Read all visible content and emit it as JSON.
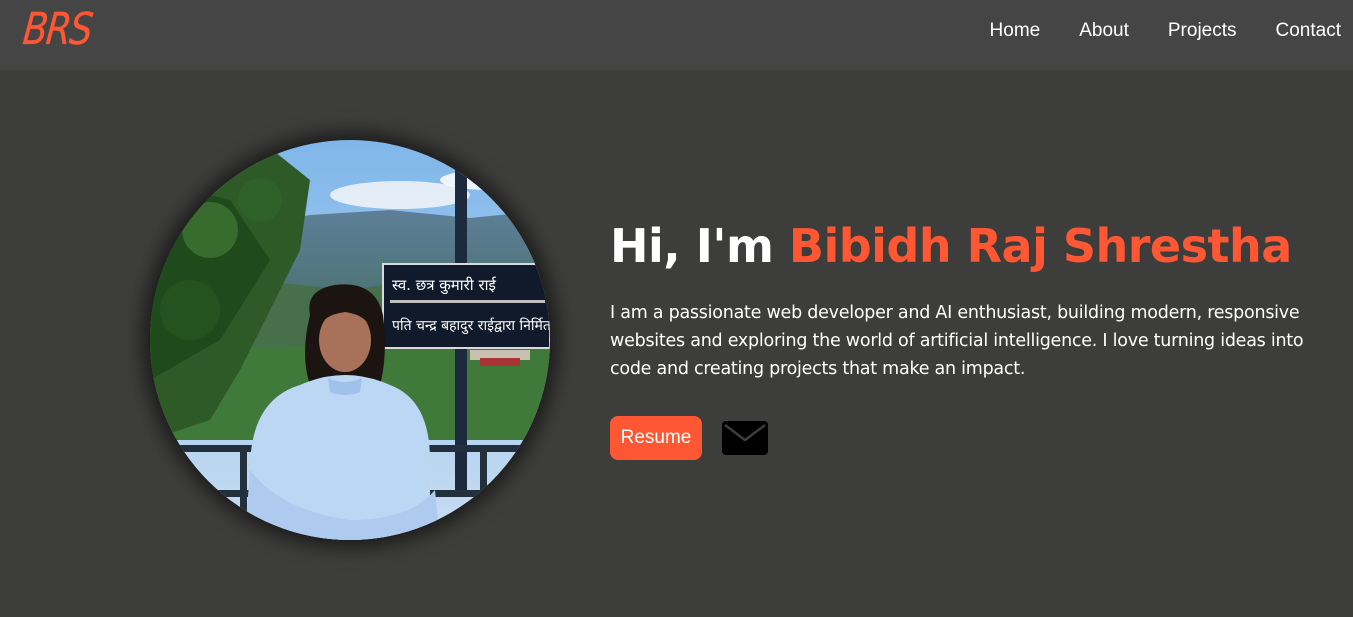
{
  "header": {
    "logo": "BRS",
    "nav": [
      {
        "label": "Home"
      },
      {
        "label": "About"
      },
      {
        "label": "Projects"
      },
      {
        "label": "Contact"
      }
    ]
  },
  "hero": {
    "greeting": "Hi, I'm ",
    "name": "Bibidh Raj Shrestha",
    "intro": "I am a passionate web developer and AI enthusiast, building modern, responsive websites and exploring the world of artificial intelligence. I love turning ideas into code and creating projects that make an impact.",
    "sign_line1": "स्व. छत्र कुमारी राई",
    "sign_line2": "पति चन्द्र बहादुर राईद्वारा निर्मित",
    "resume_label": "Resume",
    "mail_icon": "envelope-icon"
  },
  "colors": {
    "accent": "#ff5733",
    "background": "#3d3d3c",
    "navbar": "#454545"
  }
}
